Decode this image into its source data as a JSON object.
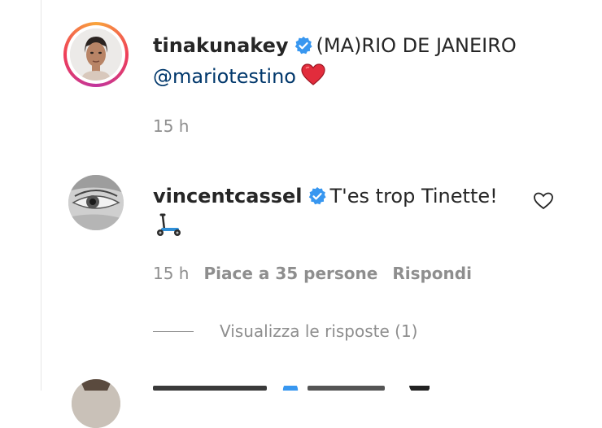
{
  "comments": [
    {
      "username": "tinakunakey",
      "verified": true,
      "text": "(MA)RIO DE JANEIRO",
      "mention": "@mariotestino",
      "emoji": "red-heart",
      "time": "15 h"
    },
    {
      "username": "vincentcassel",
      "verified": true,
      "text": "T'es trop Tinette!",
      "emoji": "kick-scooter",
      "time": "15 h",
      "likes": "Piace a 35 persone",
      "reply": "Rispondi",
      "view_replies": "Visualizza le risposte (1)"
    },
    {
      "partial": true
    }
  ],
  "colors": {
    "verified": "#3897f0",
    "text": "#262626",
    "meta": "#8e8e8e",
    "mention": "#00376b",
    "heart": "#ed4956"
  }
}
